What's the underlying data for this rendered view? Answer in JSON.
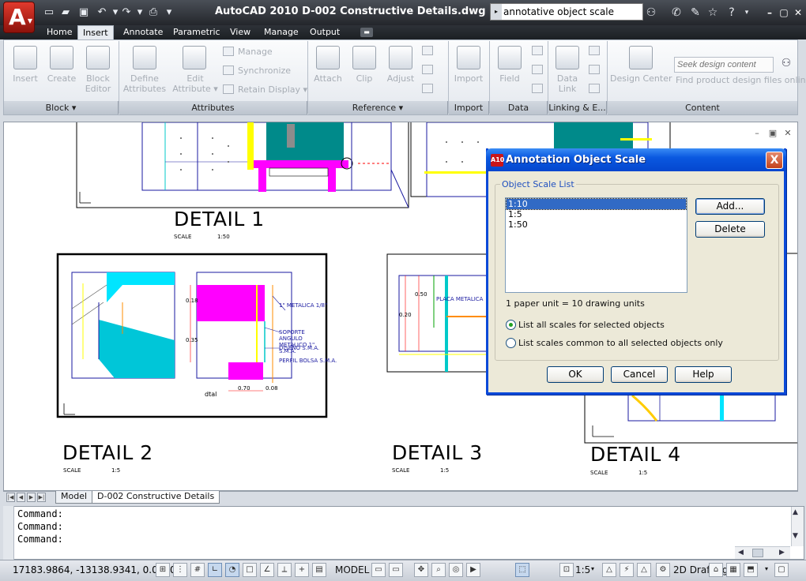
{
  "app": {
    "title": "AutoCAD 2010    D-002 Constructive Details.dwg",
    "logo_letter": "A",
    "logo_caret": "▼"
  },
  "search": {
    "value": "annotative object scale",
    "caret": "▸"
  },
  "ribbon": {
    "tabs": [
      "Home",
      "Insert",
      "Annotate",
      "Parametric",
      "View",
      "Manage",
      "Output"
    ],
    "active_tab": "Insert",
    "panels": [
      {
        "title": "Block ▾"
      },
      {
        "title": "Attributes"
      },
      {
        "title": "Reference ▾"
      },
      {
        "title": "Import"
      },
      {
        "title": "Data"
      },
      {
        "title": "Linking & E..."
      },
      {
        "title": "Content"
      }
    ],
    "buttons": {
      "insert": "Insert",
      "create": "Create",
      "block_editor_1": "Block",
      "block_editor_2": "Editor",
      "define_attr_1": "Define",
      "define_attr_2": "Attributes",
      "edit_attr_1": "Edit",
      "edit_attr_2": "Attribute ▾",
      "manage": "Manage",
      "synchronize": "Synchronize",
      "retain_display": "Retain Display ▾",
      "attach": "Attach",
      "clip": "Clip",
      "adjust": "Adjust",
      "import": "Import",
      "field": "Field",
      "data_link_1": "Data",
      "data_link_2": "Link",
      "design_center": "Design Center",
      "seek_placeholder": "Seek design content",
      "find_product": "Find product design files online"
    }
  },
  "drawing": {
    "details": [
      {
        "title": "DETAIL 1",
        "scale_label": "SCALE",
        "scale": "1:50"
      },
      {
        "title": "DETAIL 2",
        "scale_label": "SCALE",
        "scale": "1:5"
      },
      {
        "title": "DETAIL 3",
        "scale_label": "SCALE",
        "scale": "1:5"
      },
      {
        "title": "DETAIL 4",
        "scale_label": "SCALE",
        "scale": "1:5"
      }
    ],
    "annotations": {
      "d2_a": "1\" METALICA 1/8\"",
      "d2_b": "SOPORTE ANGULO METALICO 1\" S.M.A.",
      "d2_c": "DISEÑO S.M.A.",
      "d2_d": "PERFIL BOLSA S.M.A.",
      "d2_dim": "0.70",
      "d2_dim2": "0.08",
      "d2_dim3": "0.18",
      "d2_dim4": "0.35",
      "d2_note": "dtal",
      "d3_a": "PLACA METALICA",
      "d3_dim": "0.50",
      "d3_dim2": "0.20"
    }
  },
  "layout_tabs": [
    "Model",
    "D-002 Constructive Details"
  ],
  "active_layout": "D-002 Constructive Details",
  "command_lines": [
    "Command:",
    "Command:",
    "Command:"
  ],
  "status": {
    "coordinates": "17183.9864, -13138.9341, 0.0000",
    "model_label": "MODEL",
    "annotation_scale": "1:5",
    "workspace": "2D Drafting"
  },
  "dialog": {
    "title": "Annotation Object Scale",
    "icon_label": "A10",
    "close": "X",
    "group_label": "Object Scale List",
    "scales": [
      "1:10",
      "1:5",
      "1:50"
    ],
    "selected_scale": "1:10",
    "add_button": "Add...",
    "delete_button": "Delete",
    "units_text": "1 paper unit = 10 drawing units",
    "radio_all": "List all scales for selected objects",
    "radio_common": "List scales common to all selected objects only",
    "radio_selected": "all",
    "ok": "OK",
    "cancel": "Cancel",
    "help": "Help"
  },
  "colors": {
    "accent_magenta": "#ff00ff",
    "accent_teal": "#008a8a",
    "accent_cyan": "#00e5ff",
    "xp_title_blue": "#0a58e0"
  }
}
